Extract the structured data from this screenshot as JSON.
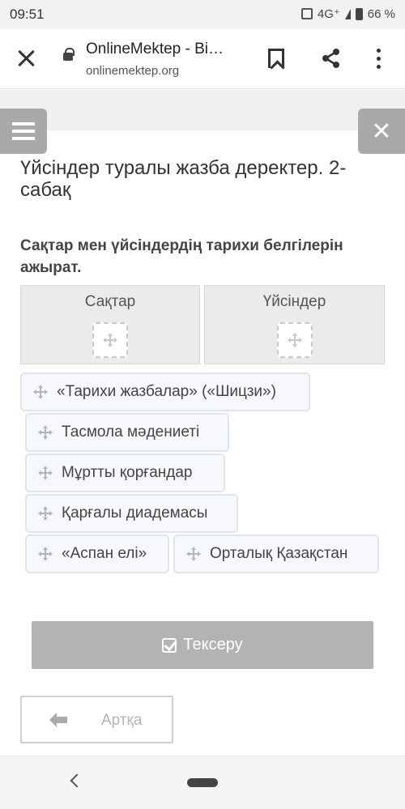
{
  "status_bar": {
    "time": "09:51",
    "network": "4G⁺",
    "battery": "66 %"
  },
  "browser": {
    "title": "OnlineMektep - Bi…",
    "domain": "onlinemektep.org"
  },
  "lesson": {
    "title": "Үйсіндер туралы жазба деректер. 2-сабақ"
  },
  "task": {
    "instruction": "Сақтар мен үйсіндердің тарихи белгілерін ажырат.",
    "zones": [
      {
        "label": "Сақтар"
      },
      {
        "label": "Үйсіндер"
      }
    ],
    "items": [
      "«Тарихи жазбалар» («Шицзи»)",
      "Тасмола мәдениеті",
      "Мұртты қорғандар",
      "Қарғалы диадемасы",
      "«Аспан елі»",
      "Орталық Қазақстан"
    ]
  },
  "buttons": {
    "check": "Тексеру",
    "back": "Артқа"
  },
  "icons": {
    "close": "close-icon",
    "lock": "lock-icon",
    "bookmark": "bookmark-icon",
    "share": "share-icon",
    "more": "more-vert-icon",
    "menu": "menu-icon",
    "exit": "close-icon",
    "drag": "move-icon",
    "check": "checkbox-icon",
    "back": "arrow-left-icon"
  },
  "colors": {
    "button_disabled": "#b3b3b3",
    "panel": "#ebebeb",
    "chip_border": "#dfe5ef"
  }
}
